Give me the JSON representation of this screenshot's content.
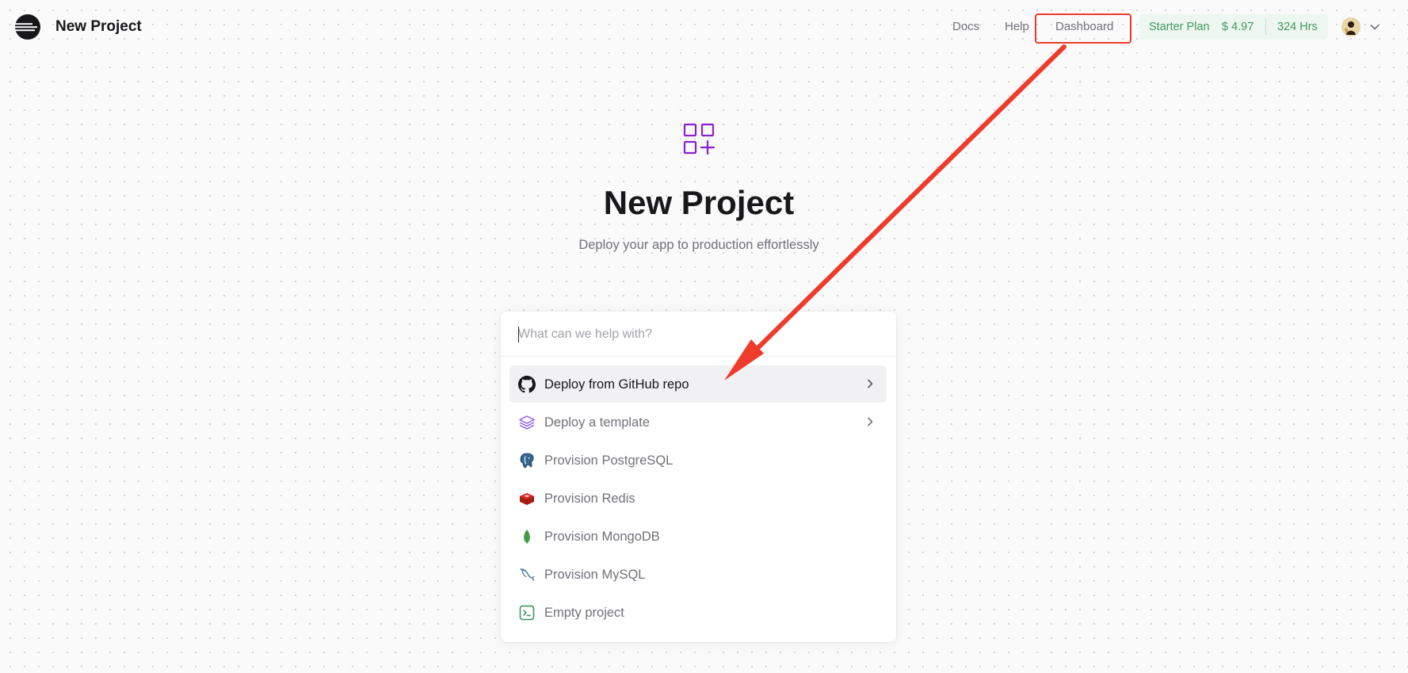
{
  "header": {
    "app_title": "New Project",
    "nav": {
      "docs": "Docs",
      "help": "Help",
      "dashboard": "Dashboard"
    },
    "plan": {
      "name": "Starter Plan",
      "cost": "$ 4.97",
      "hours": "324 Hrs"
    }
  },
  "hero": {
    "title": "New Project",
    "subtitle": "Deploy your app to production effortlessly"
  },
  "command": {
    "placeholder": "What can we help with?",
    "value": "",
    "items": [
      {
        "label": "Deploy from GitHub repo",
        "icon": "github-icon",
        "has_chevron": true,
        "active": true
      },
      {
        "label": "Deploy a template",
        "icon": "layers-icon",
        "has_chevron": true,
        "active": false
      },
      {
        "label": "Provision PostgreSQL",
        "icon": "postgresql-icon",
        "has_chevron": false,
        "active": false
      },
      {
        "label": "Provision Redis",
        "icon": "redis-icon",
        "has_chevron": false,
        "active": false
      },
      {
        "label": "Provision MongoDB",
        "icon": "mongodb-icon",
        "has_chevron": false,
        "active": false
      },
      {
        "label": "Provision MySQL",
        "icon": "mysql-icon",
        "has_chevron": false,
        "active": false
      },
      {
        "label": "Empty project",
        "icon": "terminal-icon",
        "has_chevron": false,
        "active": false
      }
    ]
  },
  "colors": {
    "accent_purple": "#8b22c9",
    "plan_green": "#3f9a62",
    "annotation_red": "#ef3b2c"
  }
}
